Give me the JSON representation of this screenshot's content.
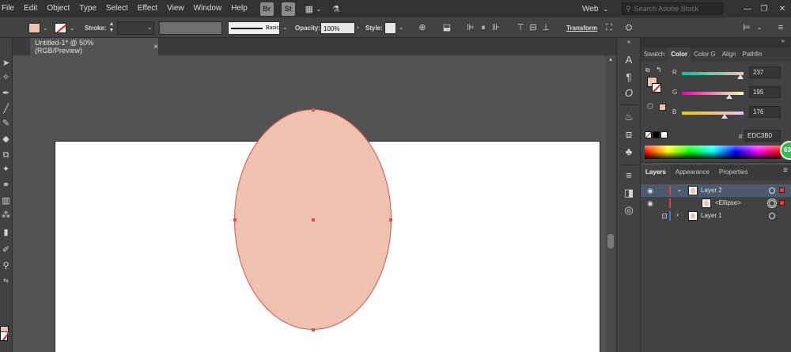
{
  "menubar": {
    "items": [
      "File",
      "Edit",
      "Object",
      "Type",
      "Select",
      "Effect",
      "View",
      "Window",
      "Help"
    ],
    "bridge": "Br",
    "stock": "St",
    "workspace": "Web",
    "search_placeholder": "Search Adobe Stock"
  },
  "controlbar": {
    "stroke_label": "Stroke:",
    "brush_label": "Basic",
    "opacity_label": "Opacity:",
    "opacity_value": "100%",
    "style_label": "Style:",
    "transform_label": "Transform",
    "fill_color": "#EDC3B0"
  },
  "document": {
    "tab_title": "Untitled-1* @ 50% (RGB/Preview)",
    "close_glyph": "×"
  },
  "color_panel": {
    "tabs": [
      "Swatch",
      "Color",
      "Color G",
      "Align",
      "Pathfin"
    ],
    "active_tab": "Color",
    "r_label": "R",
    "r_value": "237",
    "g_label": "G",
    "g_value": "195",
    "b_label": "B",
    "b_value": "176",
    "hex_label": "#",
    "hex_value": "EDC3B0"
  },
  "badge": "63",
  "layers_panel": {
    "tabs": [
      "Layers",
      "Appearance",
      "Properties"
    ],
    "rows": [
      {
        "name": "Layer 2",
        "color": "#e04040"
      },
      {
        "name": "<Ellipse>",
        "color": "#e04040"
      },
      {
        "name": "Layer 1",
        "color": "#4a6ee0"
      }
    ]
  },
  "colors": {
    "ellipse_fill": "#EDC3B0",
    "ellipse_stroke": "#e05050",
    "selection": "#4b5a6e"
  }
}
